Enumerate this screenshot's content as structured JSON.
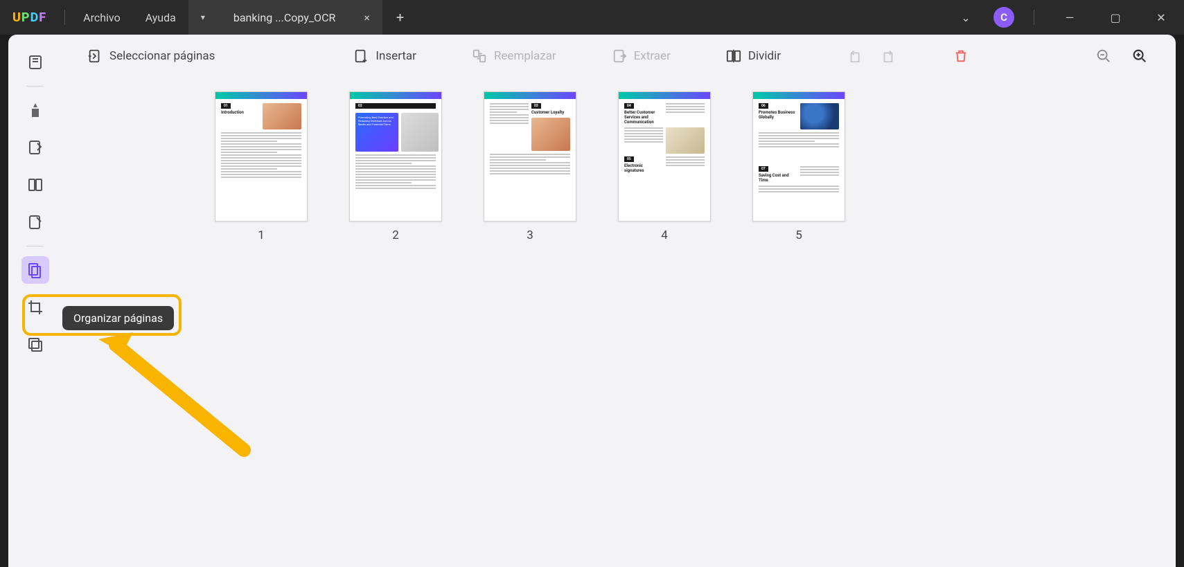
{
  "app": {
    "logo_letters": [
      "U",
      "P",
      "D",
      "F"
    ]
  },
  "menu": {
    "archivo": "Archivo",
    "ayuda": "Ayuda"
  },
  "tab": {
    "title": "banking ...Copy_OCR",
    "close": "×",
    "chev": "▾",
    "plus": "+"
  },
  "window": {
    "collapse": "⌄",
    "min": "—",
    "max": "▢",
    "close": "✕"
  },
  "avatar": {
    "initial": "C"
  },
  "toolbar": {
    "select": "Seleccionar páginas",
    "insert": "Insertar",
    "replace": "Reemplazar",
    "extract": "Extraer",
    "split": "Dividir"
  },
  "sidebar": {
    "tooltip": "Organizar páginas"
  },
  "pages": [
    {
      "num": "1",
      "badge": "01",
      "heading": "Introduction"
    },
    {
      "num": "2",
      "badge": "02",
      "heading": "Promoting Best Practice and Reducing Workload Across Banks and Financial Firms"
    },
    {
      "num": "3",
      "badge": "03",
      "heading": "Customer Loyalty"
    },
    {
      "num": "4",
      "badge": "04",
      "heading": "Better Customer Services and Communication",
      "badge2": "05",
      "heading2": "Electronic signatures"
    },
    {
      "num": "5",
      "badge": "06",
      "heading": "Promotes Business Globally",
      "badge2": "07",
      "heading2": "Saving Cost and Time"
    }
  ]
}
